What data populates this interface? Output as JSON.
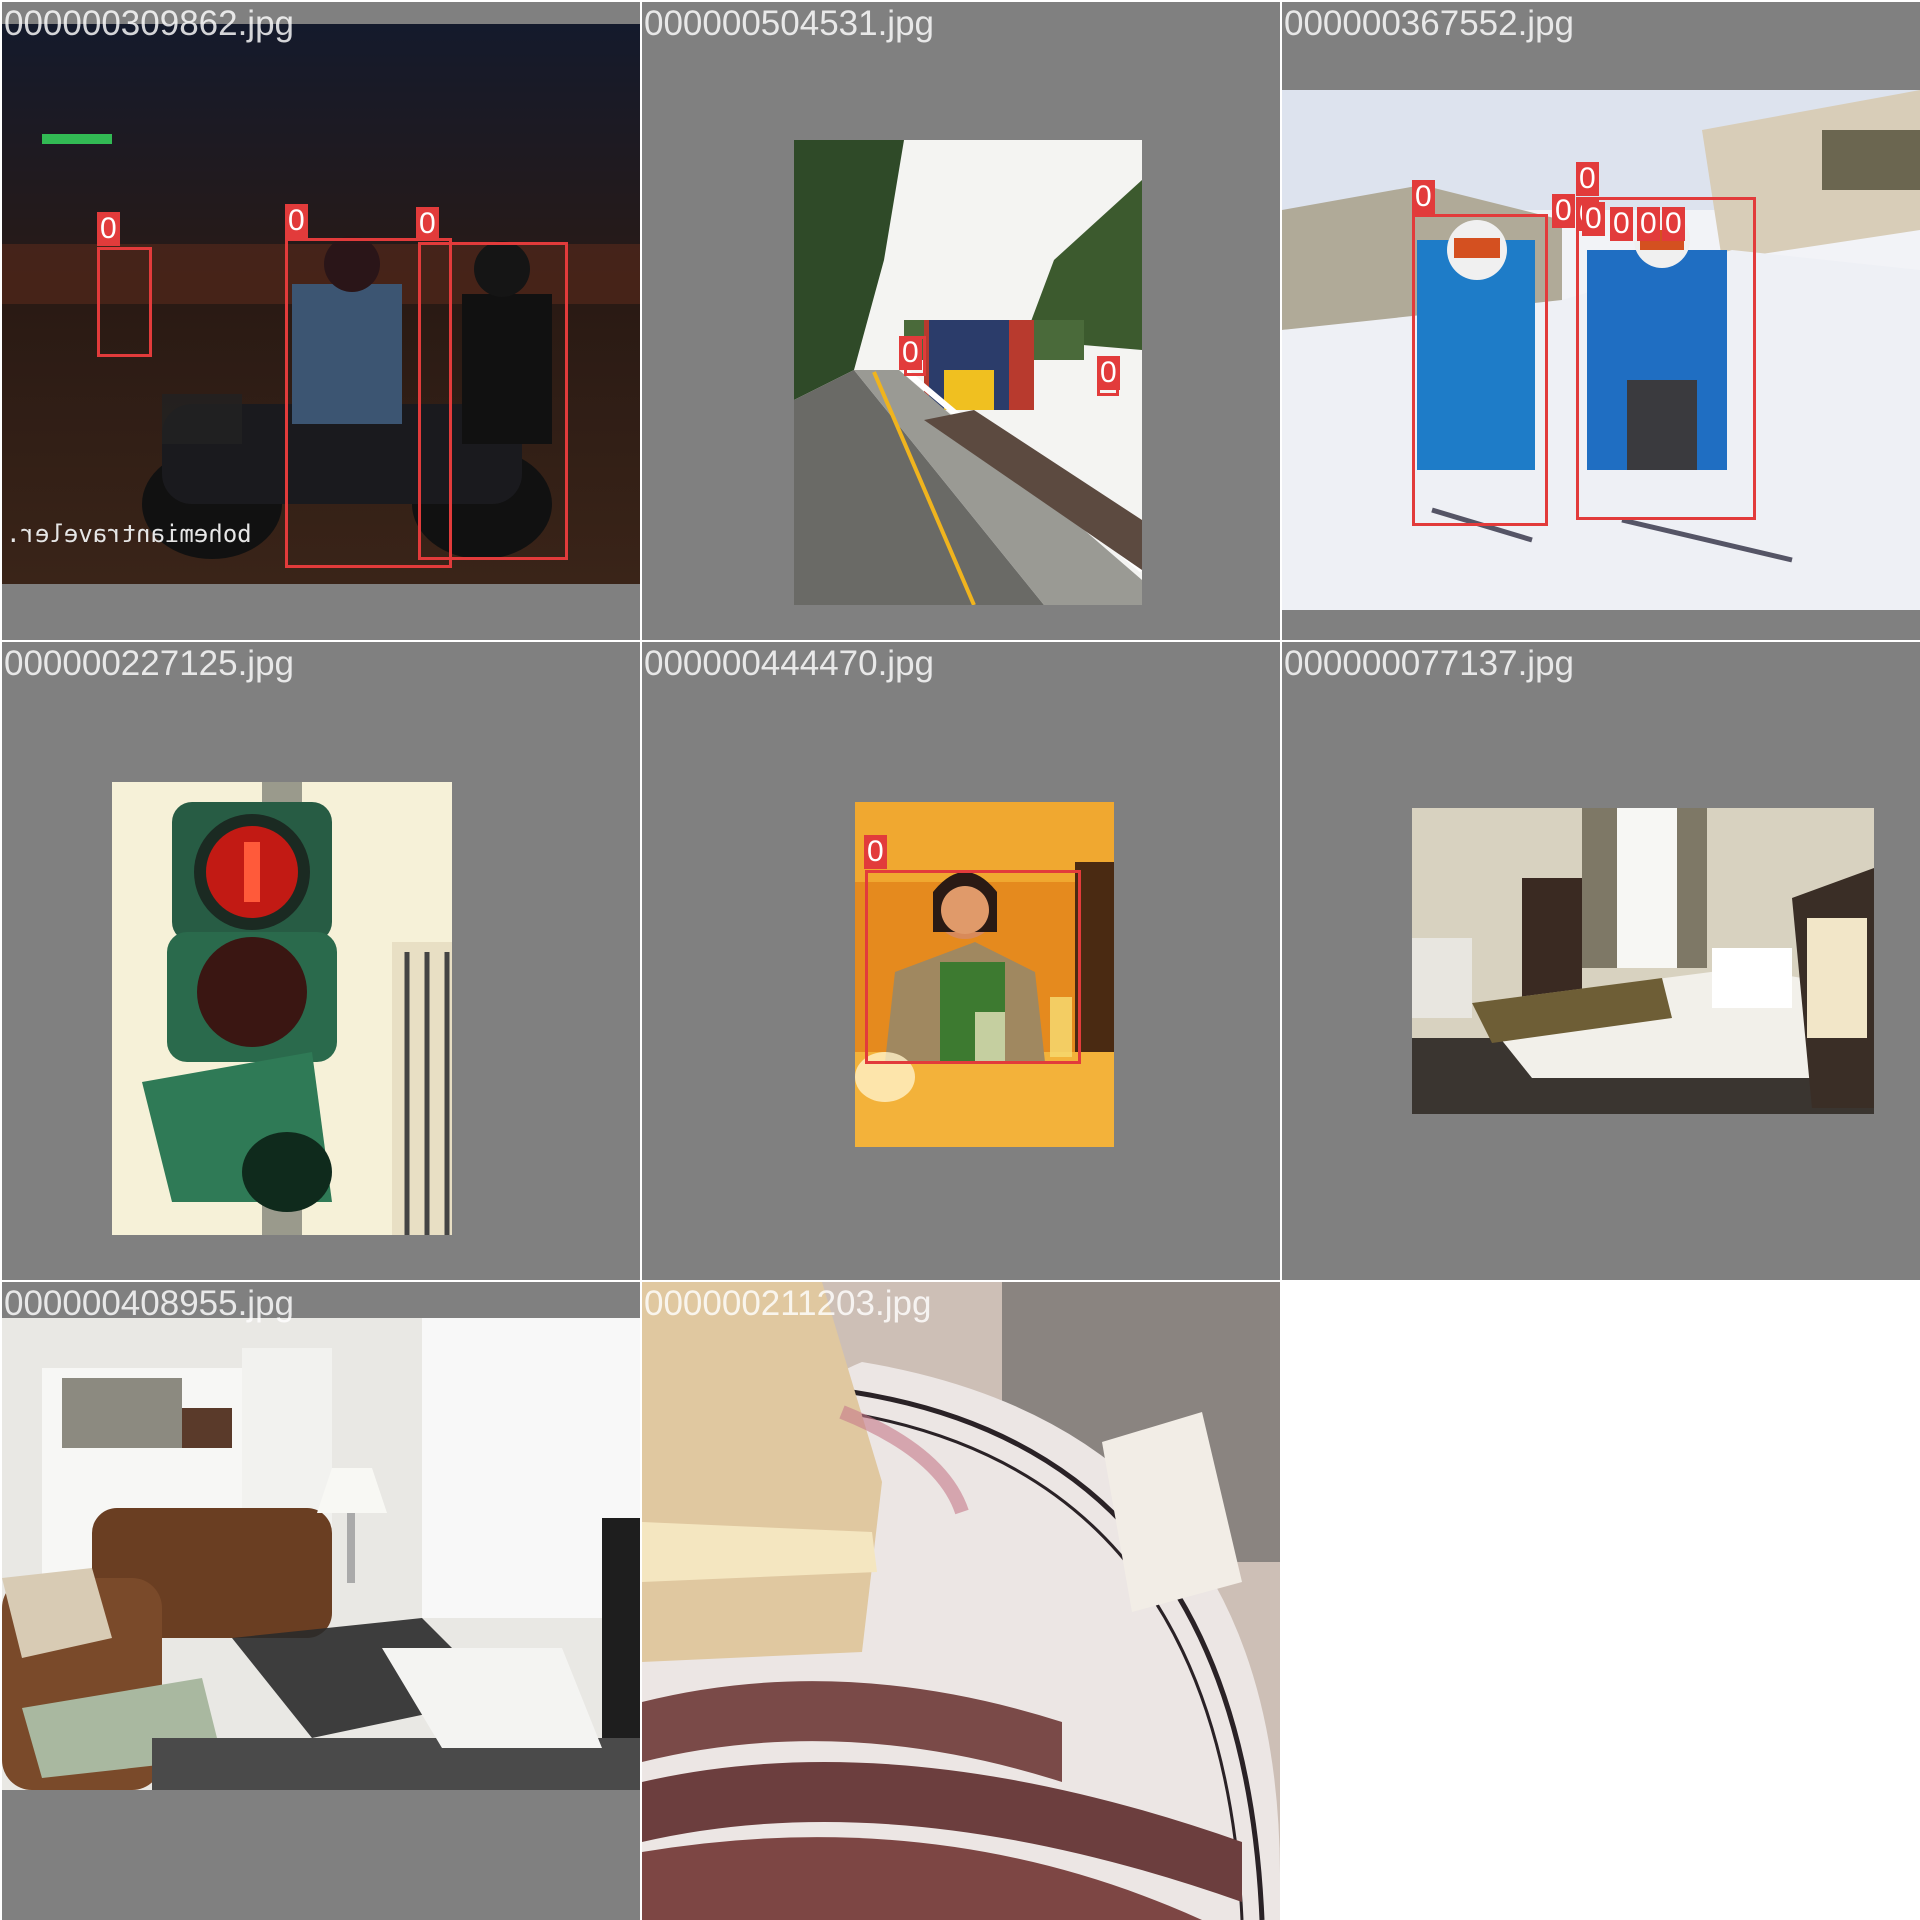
{
  "tiles": [
    {
      "filename": "000000309862.jpg",
      "labels": [
        "0",
        "0",
        "0"
      ],
      "watermark": "bohemiantraveler."
    },
    {
      "filename": "000000504531.jpg",
      "labels": [
        "0",
        "0"
      ]
    },
    {
      "filename": "000000367552.jpg",
      "labels": [
        "0",
        "0",
        "0",
        "0",
        "0",
        "0",
        "0",
        "0"
      ]
    },
    {
      "filename": "000000227125.jpg",
      "labels": []
    },
    {
      "filename": "000000444470.jpg",
      "labels": [
        "0"
      ]
    },
    {
      "filename": "000000077137.jpg",
      "labels": []
    },
    {
      "filename": "000000408955.jpg",
      "labels": []
    },
    {
      "filename": "000000211203.jpg",
      "labels": []
    }
  ],
  "colors": {
    "tile_background": "#808080",
    "box": "#e23b3b",
    "page": "#ffffff"
  }
}
